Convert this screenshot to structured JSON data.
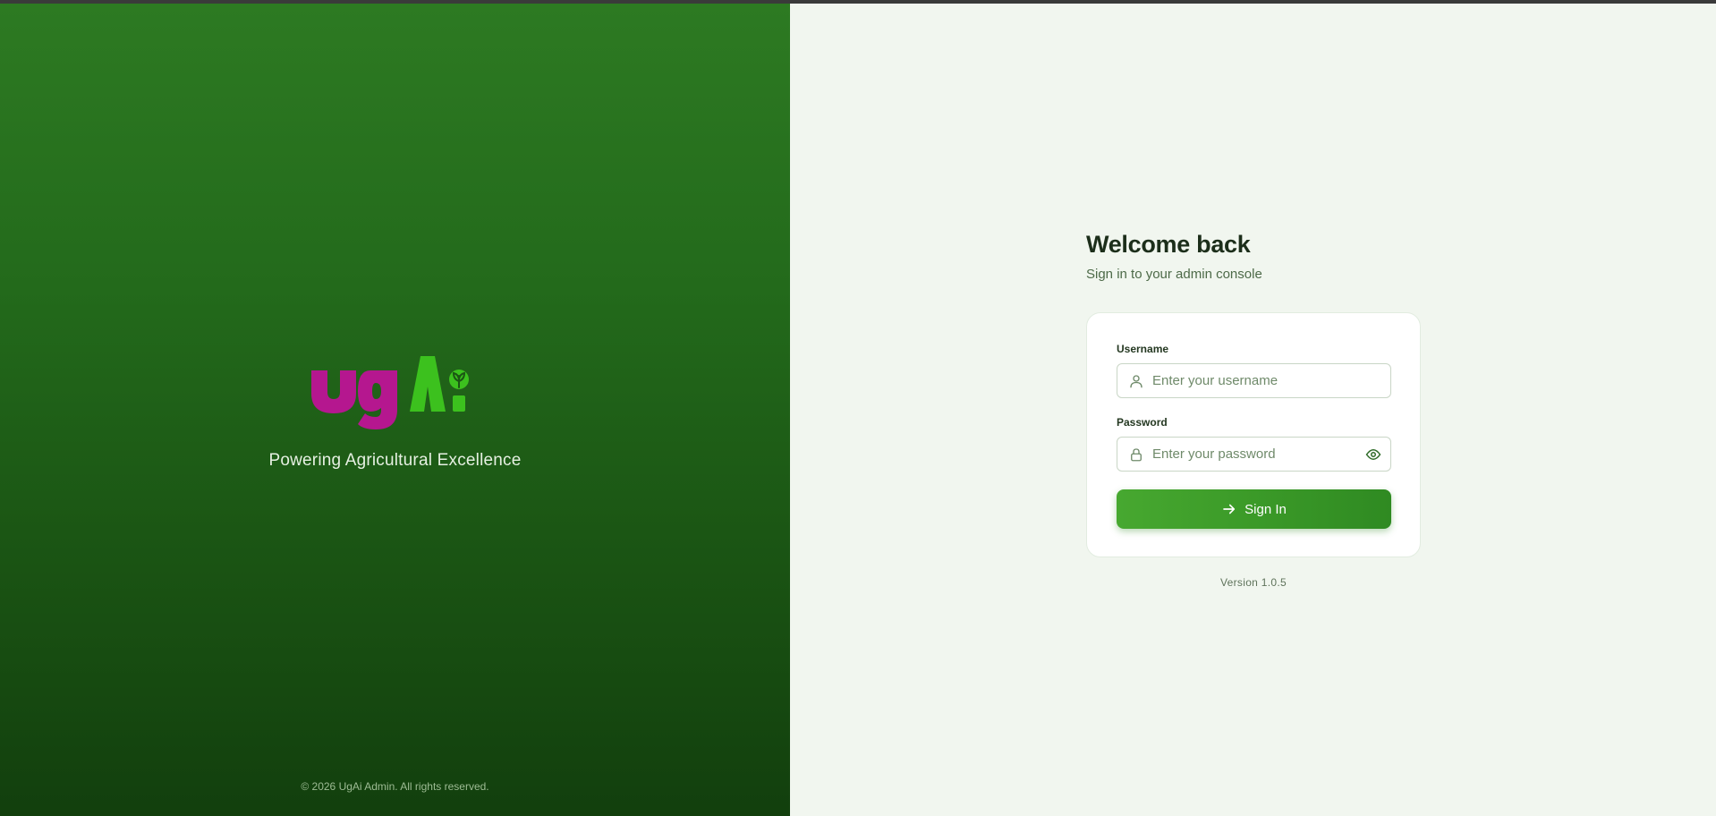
{
  "brand": {
    "logo_text": "ugAi",
    "tagline": "Powering Agricultural Excellence",
    "copyright": "© 2026 UgAi Admin. All rights reserved.",
    "colors": {
      "logo_magenta": "#b5178f",
      "logo_green": "#3cc11e",
      "panel_green": "#236a1b",
      "accent_green": "#3b9a28"
    }
  },
  "login": {
    "title": "Welcome back",
    "subtitle": "Sign in to your admin console",
    "username": {
      "label": "Username",
      "placeholder": "Enter your username",
      "value": "",
      "icon": "user-icon"
    },
    "password": {
      "label": "Password",
      "placeholder": "Enter your password",
      "value": "",
      "icon": "lock-icon",
      "toggle_icon": "eye-icon"
    },
    "submit_label": "Sign In",
    "submit_icon": "arrow-right-icon"
  },
  "footer": {
    "version": "Version 1.0.5"
  }
}
